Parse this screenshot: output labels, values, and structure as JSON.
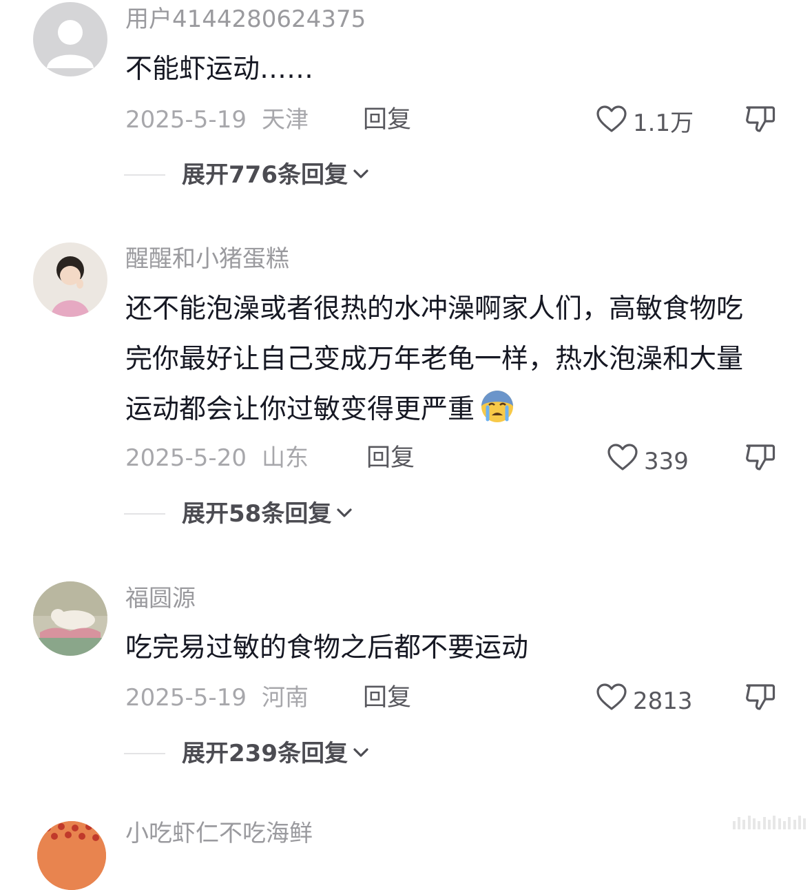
{
  "comments": [
    {
      "username": "用户4144280624375",
      "text": "不能虾运动……",
      "date": "2025-5-19",
      "location": "天津",
      "reply_label": "回复",
      "likes": "1.1万",
      "expand_label": "展开776条回复",
      "avatar": "default-user-avatar"
    },
    {
      "username": "醒醒和小猪蛋糕",
      "text": "还不能泡澡或者很热的水冲澡啊家人们，高敏食物吃完你最好让自己变成万年老龟一样，热水泡澡和大量运动都会让你过敏变得更严重",
      "emoji": "crying-face-emoji",
      "date": "2025-5-20",
      "location": "山东",
      "reply_label": "回复",
      "likes": "339",
      "expand_label": "展开58条回复",
      "avatar": "child-photo-avatar"
    },
    {
      "username": "福圆源",
      "text": "吃完易过敏的食物之后都不要运动",
      "date": "2025-5-19",
      "location": "河南",
      "reply_label": "回复",
      "likes": "2813",
      "expand_label": "展开239条回复",
      "avatar": "cat-painting-avatar"
    },
    {
      "username": "小吃虾仁不吃海鲜",
      "avatar": "heart-pattern-avatar"
    }
  ],
  "icons": {
    "like": "heart-outline-icon",
    "dislike": "thumbs-down-icon",
    "expand": "chevron-down-icon"
  },
  "colors": {
    "username": "#9a9a9e",
    "body": "#161823",
    "meta": "#a7a7ab",
    "action": "#58585e"
  }
}
